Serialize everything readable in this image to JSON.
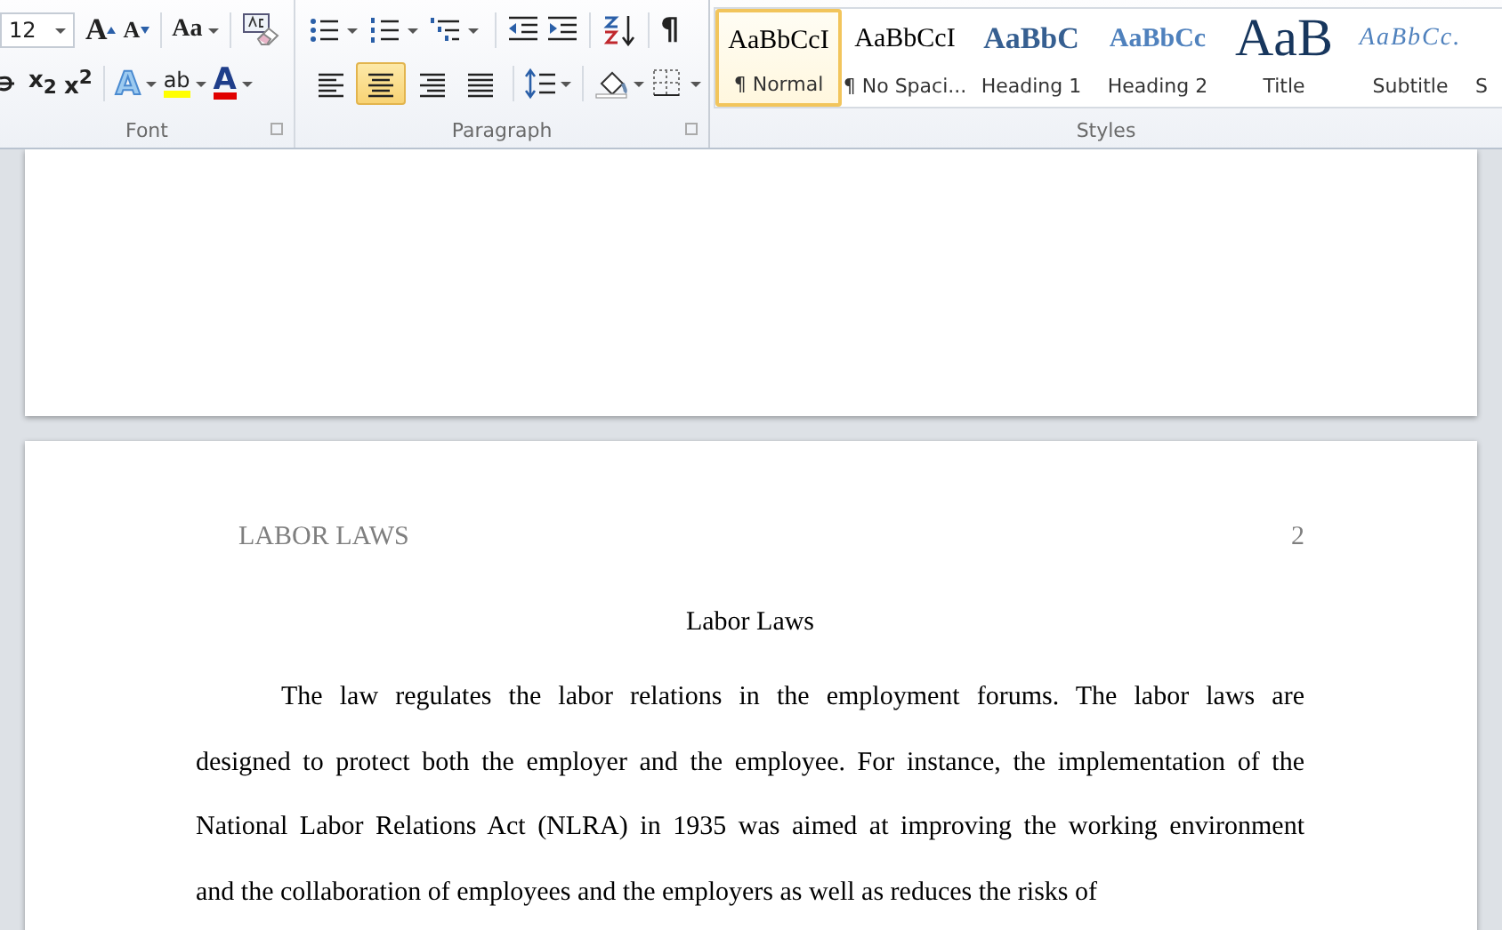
{
  "ribbon": {
    "font": {
      "label": "Font",
      "font_size": "12",
      "grow_font": "A",
      "shrink_font": "A",
      "change_case": "Aa",
      "subscript": "x$_{2}$",
      "superscript": "x$^{2}$",
      "text_effects": "A",
      "highlight": "ab",
      "font_color": "A"
    },
    "paragraph": {
      "label": "Paragraph",
      "show_marks": "¶",
      "alignment": [
        {
          "kind": "left",
          "selected": false
        },
        {
          "kind": "center",
          "selected": true
        },
        {
          "kind": "right",
          "selected": false
        },
        {
          "kind": "justify",
          "selected": false
        }
      ]
    },
    "styles": {
      "label": "Styles",
      "items": [
        {
          "kind": "normal",
          "sample": "AaBbCcI",
          "label": "¶ Normal",
          "selected": true
        },
        {
          "kind": "normal",
          "sample": "AaBbCcI",
          "label": "¶ No Spaci...",
          "selected": false
        },
        {
          "kind": "heading1",
          "sample": "AaBbC",
          "label": "Heading 1",
          "selected": false
        },
        {
          "kind": "heading2",
          "sample": "AaBbCc",
          "label": "Heading 2",
          "selected": false
        },
        {
          "kind": "title",
          "sample": "AaB",
          "label": "Title",
          "selected": false
        },
        {
          "kind": "subtitle",
          "sample": "AaBbCc.",
          "label": "Subtitle",
          "selected": false
        },
        {
          "kind": "cut",
          "label": "S",
          "selected": false
        }
      ]
    }
  },
  "document": {
    "page": {
      "header": "LABOR LAWS",
      "page_number": "2",
      "title": "Labor Laws",
      "lines": [
        "The law regulates the labor relations in the employment forums. The labor laws are",
        "designed to protect both the employer and the employee. For instance, the implementation of the",
        "National Labor Relations Act (NLRA) in 1935 was aimed at improving the working environment",
        "and the collaboration of employees and the employers as well as reduces the risks of"
      ]
    }
  }
}
